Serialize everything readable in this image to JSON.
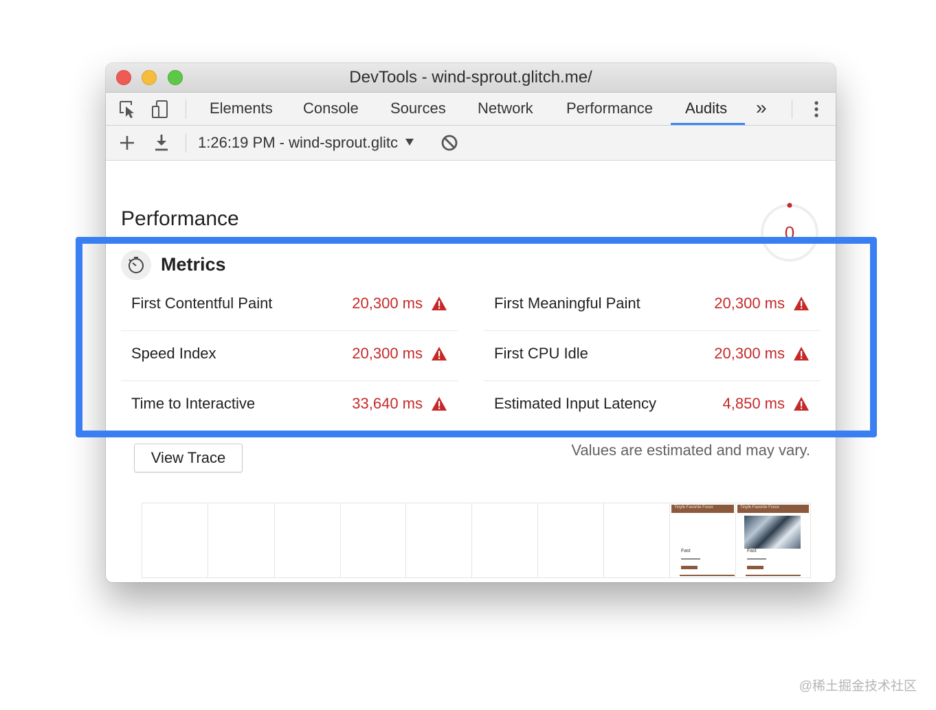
{
  "window": {
    "title": "DevTools - wind-sprout.glitch.me/"
  },
  "tabbar": {
    "tabs": [
      {
        "label": "Elements"
      },
      {
        "label": "Console"
      },
      {
        "label": "Sources"
      },
      {
        "label": "Network"
      },
      {
        "label": "Performance"
      },
      {
        "label": "Audits"
      }
    ],
    "active_tab": "Audits",
    "overflow_label": "»",
    "icons": [
      "inspect-element-icon",
      "device-toolbar-icon",
      "more-vert-icon"
    ]
  },
  "toolbar": {
    "run_label": "1:26:19 PM - wind-sprout.glitc",
    "icons": [
      "plus-icon",
      "download-icon",
      "dropdown-arrow-icon",
      "clear-icon"
    ]
  },
  "report": {
    "section_title": "Performance",
    "score": "0",
    "metrics_title": "Metrics",
    "metrics": [
      {
        "label": "First Contentful Paint",
        "value": "20,300 ms"
      },
      {
        "label": "First Meaningful Paint",
        "value": "20,300 ms"
      },
      {
        "label": "Speed Index",
        "value": "20,300 ms"
      },
      {
        "label": "First CPU Idle",
        "value": "20,300 ms"
      },
      {
        "label": "Time to Interactive",
        "value": "33,640 ms"
      },
      {
        "label": "Estimated Input Latency",
        "value": "4,850 ms"
      }
    ],
    "view_trace_label": "View Trace",
    "note": "Values are estimated and may vary.",
    "colors": {
      "fail": "#c62828",
      "highlight": "#3a7ff2",
      "active_tab": "#3b82f6"
    }
  },
  "filmstrip": {
    "frame_count": 10,
    "frames_with_content": 2,
    "thumbnail_header": "Tinyfe Favorite Fxxxx",
    "thumbnail_label": "Fast"
  },
  "watermark": "@稀土掘金技术社区"
}
